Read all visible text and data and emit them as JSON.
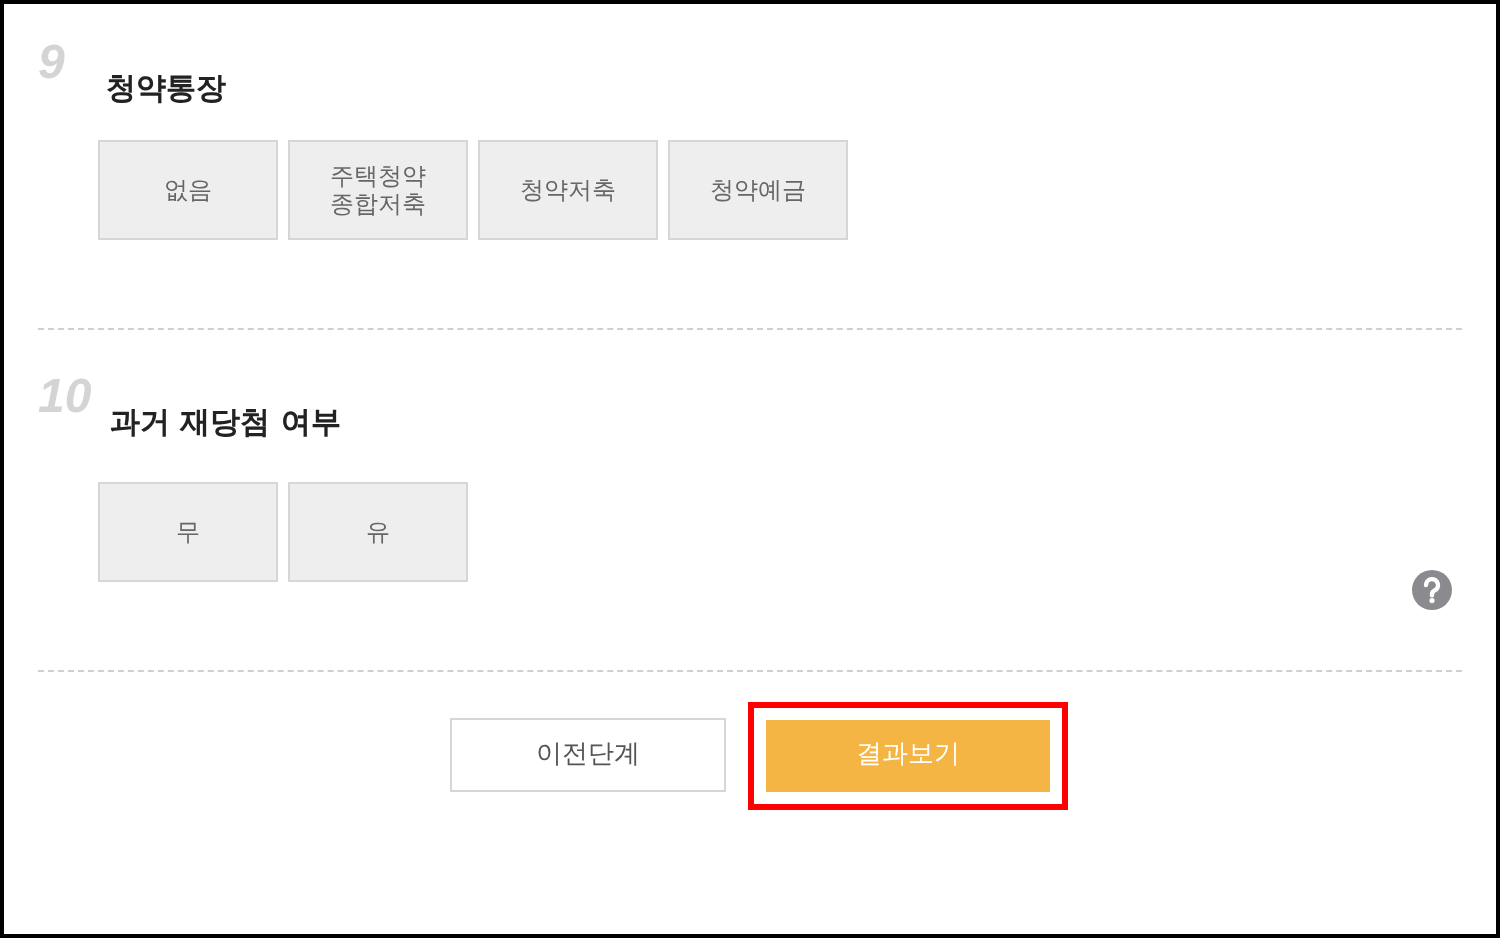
{
  "sections": [
    {
      "number": "9",
      "title": "청약통장",
      "options": [
        {
          "label": "없음",
          "selected": false
        },
        {
          "label": "주택청약\n종합저축",
          "selected": false
        },
        {
          "label": "청약저축",
          "selected": false
        },
        {
          "label": "청약예금",
          "selected": false
        }
      ]
    },
    {
      "number": "10",
      "title": "과거 재당첨 여부",
      "options": [
        {
          "label": "무",
          "selected": false
        },
        {
          "label": "유",
          "selected": false
        }
      ]
    }
  ],
  "buttons": [
    {
      "label": "이전단계",
      "kind": "secondary",
      "highlighted": false
    },
    {
      "label": "결과보기",
      "kind": "primary",
      "highlighted": true
    }
  ]
}
